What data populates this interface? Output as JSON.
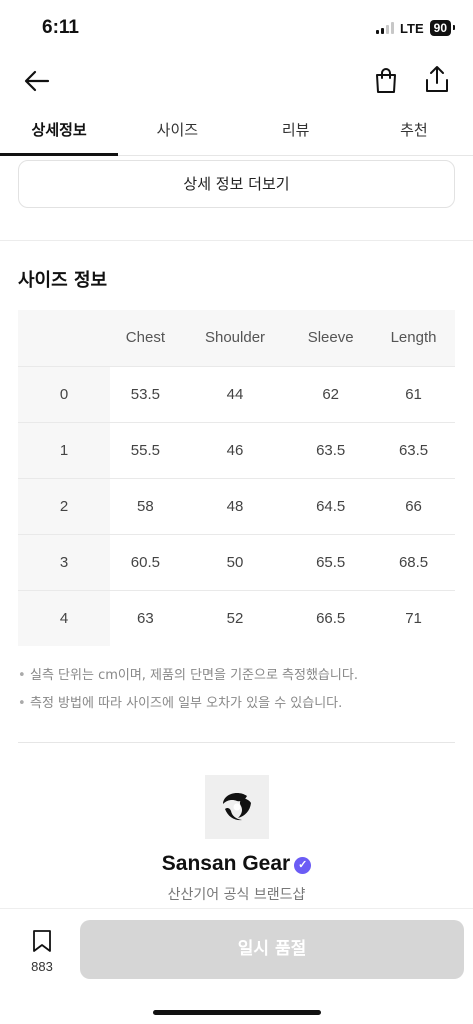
{
  "status_bar": {
    "time": "6:11",
    "network": "LTE",
    "battery": "90"
  },
  "nav": {
    "back_icon": "arrow-left-icon",
    "bag_icon": "shopping-bag-icon",
    "share_icon": "share-icon"
  },
  "tabs": [
    {
      "label": "상세정보",
      "active": true
    },
    {
      "label": "사이즈",
      "active": false
    },
    {
      "label": "리뷰",
      "active": false
    },
    {
      "label": "추천",
      "active": false
    }
  ],
  "detail_more_label": "상세 정보 더보기",
  "size_section": {
    "title": "사이즈 정보",
    "columns": [
      "Chest",
      "Shoulder",
      "Sleeve",
      "Length"
    ],
    "rows": [
      {
        "size": "0",
        "values": [
          "53.5",
          "44",
          "62",
          "61"
        ]
      },
      {
        "size": "1",
        "values": [
          "55.5",
          "46",
          "63.5",
          "63.5"
        ]
      },
      {
        "size": "2",
        "values": [
          "58",
          "48",
          "64.5",
          "66"
        ]
      },
      {
        "size": "3",
        "values": [
          "60.5",
          "50",
          "65.5",
          "68.5"
        ]
      },
      {
        "size": "4",
        "values": [
          "63",
          "52",
          "66.5",
          "71"
        ]
      }
    ],
    "notes": [
      "실측 단위는 cm이며, 제품의 단면을 기준으로 측정했습니다.",
      "측정 방법에 따라 사이즈에 일부 오차가 있을 수 있습니다."
    ]
  },
  "brand": {
    "name": "Sansan Gear",
    "description": "산산기어 공식 브랜드샵",
    "verified_icon": "verified-badge-icon"
  },
  "bottom_bar": {
    "bookmark_count": "883",
    "soldout_label": "일시 품절"
  },
  "colors": {
    "accent_verified": "#6b5cf5",
    "disabled_button": "#d6d6d6"
  }
}
